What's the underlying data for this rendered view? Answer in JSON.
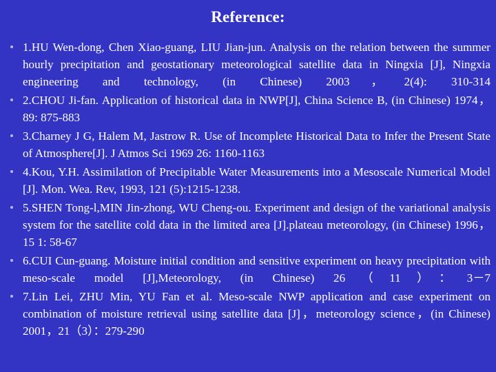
{
  "slide": {
    "title": "Reference:",
    "background_color": "#3333c4",
    "text_color": "#ffffff",
    "bullet_color": "#b9b9ef",
    "bullet_icon": "round-bullet-icon",
    "references": [
      {
        "number": "1",
        "text": "1.HU Wen-dong, Chen Xiao-guang, LIU Jian-jun. Analysis on the relation between the summer hourly precipitation and geostationary meteorological satellite data in Ningxia [J], Ningxia engineering and technology, (in Chinese) 2003，2(4): 310-314"
      },
      {
        "number": "2",
        "text": "2.CHOU Ji-fan. Application of historical data in NWP[J], China Science B, (in Chinese) 1974，89: 875-883"
      },
      {
        "number": "3",
        "text": "3.Charney J G, Halem M, Jastrow R. Use of Incomplete Historical Data to Infer the Present State of Atmosphere[J]. J Atmos Sci 1969 26: 1160-1163"
      },
      {
        "number": "4",
        "text": "4.Kou, Y.H. Assimilation of Precipitable Water Measurements into a Mesoscale Numerical Model [J]. Mon. Wea. Rev, 1993, 121 (5):1215-1238."
      },
      {
        "number": "5",
        "text": "5.SHEN Tong-l,MIN Jin-zhong, WU Cheng-ou. Experiment and design of the variational analysis system for the satellite cold data in the limited area [J].plateau meteorology, (in Chinese) 1996，15 1: 58-67"
      },
      {
        "number": "6",
        "text": "6.CUI Cun-guang. Moisture initial condition and sensitive experiment on heavy precipitation with meso-scale model [J],Meteorology, (in Chinese) 26（11）：3－7"
      },
      {
        "number": "7",
        "text": "7.Lin Lei, ZHU Min, YU Fan et al. Meso-scale NWP application and case experiment on combination of moisture retrieval using satellite data [J]，meteorology science，(in Chinese) 2001，21（3）：279-290"
      }
    ]
  }
}
